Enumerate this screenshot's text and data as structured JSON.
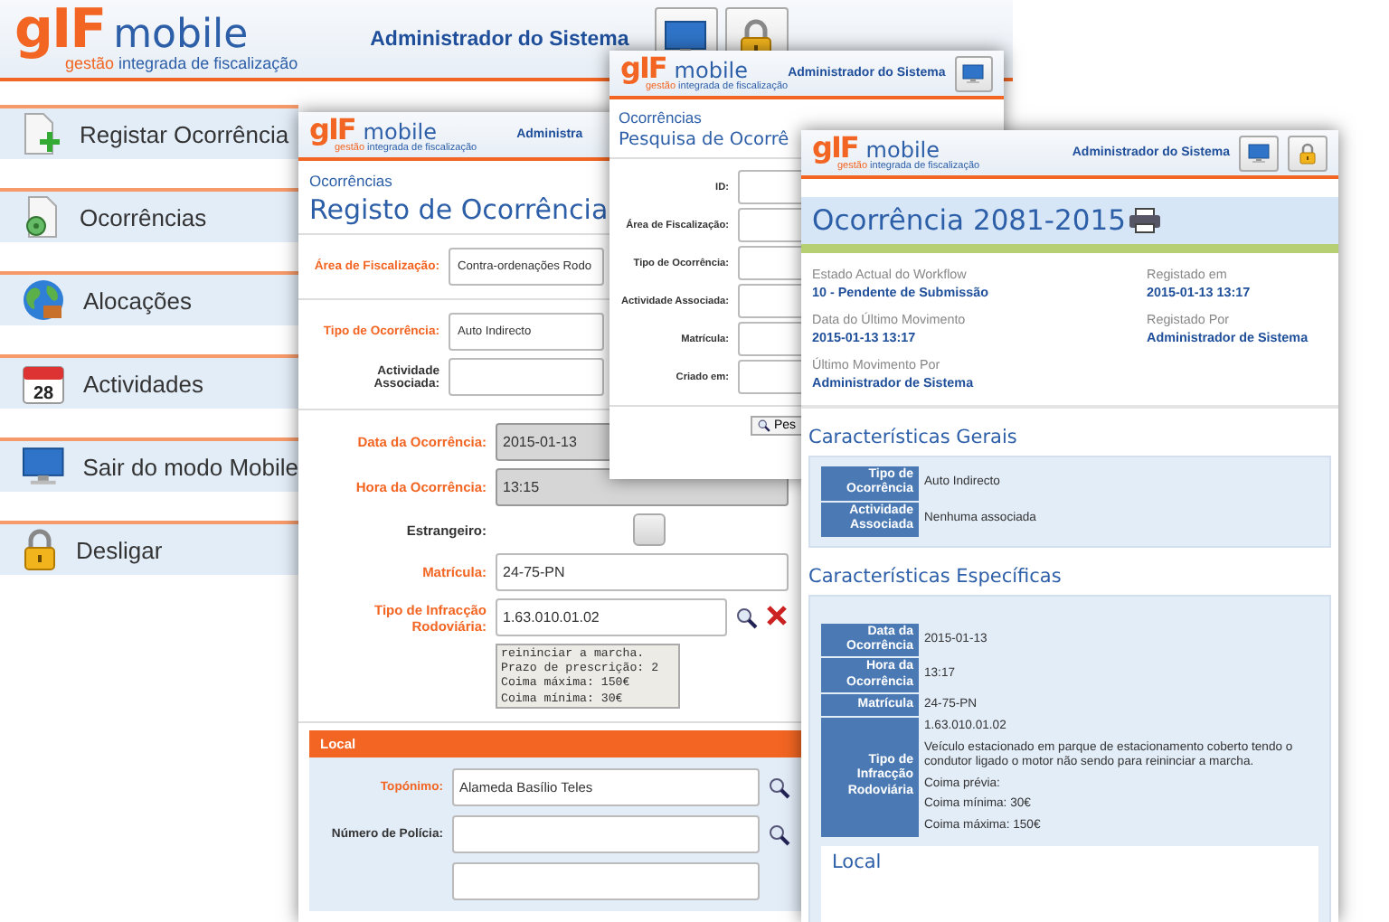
{
  "main_window": {
    "logo": {
      "mark": "gIF",
      "name": "mobile",
      "tagline_accent": "gestão",
      "tagline": "integrada de fiscalização"
    },
    "user": "Administrador do Sistema",
    "header_buttons": [
      {
        "kind": "monitor"
      },
      {
        "kind": "padlock"
      }
    ],
    "menu": [
      {
        "kind": "register",
        "label": "Registar Ocorrência"
      },
      {
        "kind": "records",
        "label": "Ocorrências"
      },
      {
        "kind": "allocations",
        "label": "Alocações"
      },
      {
        "kind": "calendar",
        "label": "Actividades",
        "icon_text": "28"
      },
      {
        "kind": "monitor",
        "label": "Sair do modo Mobile"
      },
      {
        "kind": "padlock",
        "label": "Desligar"
      }
    ]
  },
  "register_window": {
    "logo": {
      "mark": "gIF",
      "name": "mobile",
      "tagline_accent": "gestão",
      "tagline": "integrada de fiscalização"
    },
    "user": "Administra",
    "breadcrumb": "Ocorrências",
    "title": "Registo de Ocorrência",
    "sections": [
      [
        {
          "kind": "select",
          "label": "Área de Fiscalização:",
          "value": "Contra-ordenações Rodo",
          "required": true
        }
      ],
      [
        {
          "kind": "select",
          "label": "Tipo de Ocorrência:",
          "value": "Auto Indirecto",
          "required": true
        },
        {
          "kind": "select",
          "label": "Actividade Associada:",
          "required": false
        }
      ],
      [
        {
          "kind": "readonly",
          "label": "Data da Ocorrência:",
          "value": "2015-01-13",
          "required": true
        },
        {
          "kind": "readonly",
          "label": "Hora da Ocorrência:",
          "value": "13:15",
          "required": true
        },
        {
          "kind": "checkbox",
          "label": "Estrangeiro:",
          "required": false,
          "checked": false
        },
        {
          "kind": "input",
          "label": "Matrícula:",
          "value": "24-75-PN",
          "required": true
        },
        {
          "kind": "lookup",
          "label": "Tipo de Infracção Rodoviária:",
          "value": "1.63.010.01.02",
          "required": true,
          "removable": true,
          "details": [
            "reininciar a marcha.",
            "Prazo de prescrição: 2",
            "Coima máxima: 150€",
            "Coima mínima: 30€"
          ]
        }
      ]
    ],
    "local": {
      "title": "Local",
      "fields": [
        {
          "kind": "lookup",
          "label": "Topónimo:",
          "value": "Alameda Basílio Teles",
          "required": true
        },
        {
          "kind": "lookup",
          "label": "Número de Polícia:",
          "required": false
        },
        {
          "kind": "input",
          "required": false
        }
      ]
    }
  },
  "search_window": {
    "logo": {
      "mark": "gIF",
      "name": "mobile",
      "tagline_accent": "gestão",
      "tagline": "integrada de fiscalização"
    },
    "user": "Administrador do Sistema",
    "header_buttons": [
      {
        "kind": "monitor"
      }
    ],
    "breadcrumb": "Ocorrências",
    "title": "Pesquisa de Ocorrê",
    "fields": [
      {
        "label": "ID:"
      },
      {
        "label": "Área de Fiscalização:"
      },
      {
        "label": "Tipo de Ocorrência:"
      },
      {
        "label": "Actividade Associada:"
      },
      {
        "label": "Matrícula:"
      },
      {
        "label": "Criado em:"
      }
    ],
    "button": "Pes"
  },
  "detail_window": {
    "logo": {
      "mark": "gIF",
      "name": "mobile",
      "tagline_accent": "gestão",
      "tagline": "integrada de fiscalização"
    },
    "user": "Administrador do Sistema",
    "header_buttons": [
      {
        "kind": "monitor"
      },
      {
        "kind": "padlock"
      }
    ],
    "title": "Ocorrência 2081-2015",
    "info": [
      {
        "label": "Estado Actual do Workflow",
        "value": "10 - Pendente de Submissão"
      },
      {
        "label": "Registado em",
        "value": "2015-01-13 13:17"
      },
      {
        "label": "Data do Último Movimento",
        "value": "2015-01-13 13:17"
      },
      {
        "label": "Registado Por",
        "value": "Administrador de Sistema"
      },
      {
        "label": "Último Movimento Por",
        "value": "Administrador de Sistema"
      }
    ],
    "general": {
      "title": "Características Gerais",
      "rows": [
        {
          "label": "Tipo de Ocorrência",
          "values": [
            "Auto Indirecto"
          ]
        },
        {
          "label": "Actividade Associada",
          "values": [
            "Nenhuma associada"
          ]
        }
      ]
    },
    "specific": {
      "title": "Características Específicas",
      "rows": [
        {
          "label": "Data da Ocorrência",
          "values": [
            "2015-01-13"
          ]
        },
        {
          "label": "Hora da Ocorrência",
          "values": [
            "13:17"
          ]
        },
        {
          "label": "Matrícula",
          "values": [
            "24-75-PN"
          ]
        },
        {
          "label": "Tipo de Infracção Rodoviária",
          "values": [
            "1.63.010.01.02",
            "Veículo estacionado em parque de estacionamento coberto tendo o condutor ligado o motor não sendo para reininciar a marcha.",
            "Coima prévia:",
            "Coima mínima: 30€",
            "Coima máxima: 150€"
          ]
        }
      ]
    },
    "local_title": "Local"
  }
}
